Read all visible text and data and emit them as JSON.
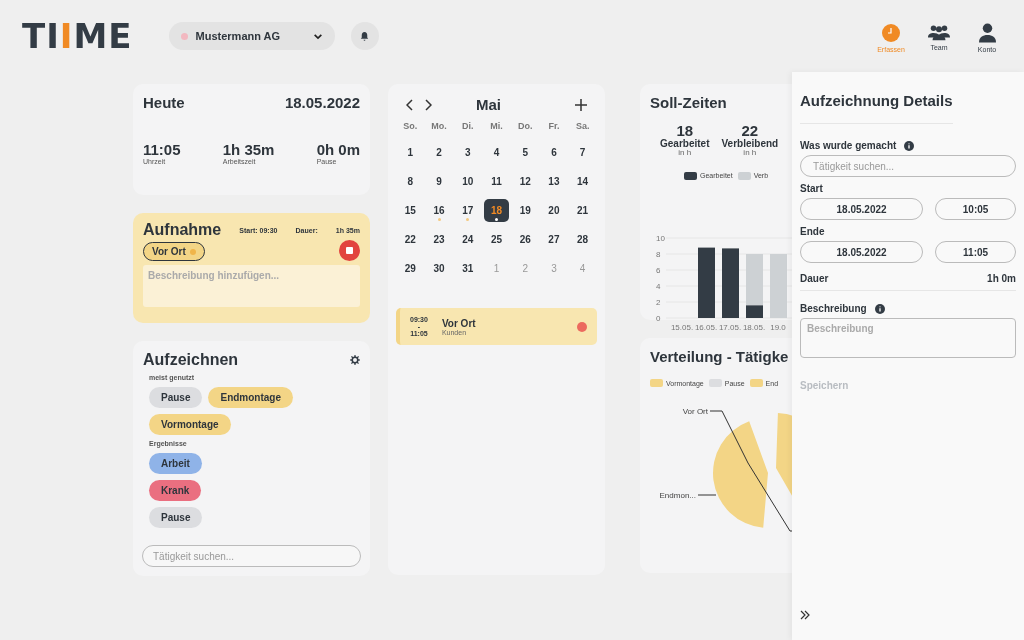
{
  "logo": [
    {
      "text": "TI",
      "accent": false
    },
    {
      "text": "I",
      "accent": true
    },
    {
      "text": "ME",
      "accent": false
    }
  ],
  "company": {
    "name": "Mustermann AG",
    "color": "#f2b8c0"
  },
  "nav": [
    {
      "label": "Erfassen",
      "kind": "clock",
      "selected": true
    },
    {
      "label": "Team",
      "kind": "team",
      "selected": false
    },
    {
      "label": "Konto",
      "kind": "user",
      "selected": false
    }
  ],
  "today": {
    "title": "Heute",
    "date": "18.05.2022",
    "stats": [
      {
        "value": "11:05",
        "label": "Uhrzeit"
      },
      {
        "value": "1h 35m",
        "label": "Arbeitszeit"
      },
      {
        "value": "0h 0m",
        "label": "Pause"
      }
    ]
  },
  "recording": {
    "title": "Aufnahme",
    "start": "Start: 09:30",
    "duration_label": "Dauer:",
    "duration": "1h 35m",
    "activity": {
      "label": "Vor Ort",
      "color": "#f0b54a"
    },
    "placeholder": "Beschreibung hinzufügen..."
  },
  "record": {
    "title": "Aufzeichnen",
    "groups": [
      {
        "label": "meist genutzt",
        "chips": [
          {
            "label": "Pause",
            "color": "#dcdde0"
          },
          {
            "label": "Endmontage",
            "color": "#f3d586"
          },
          {
            "label": "Vormontage",
            "color": "#f3d586"
          }
        ]
      },
      {
        "label": "Ergebnisse",
        "chips": [
          {
            "label": "Arbeit",
            "color": "#8fb3e8"
          },
          {
            "label": "Krank",
            "color": "#ea6f80"
          },
          {
            "label": "Pause",
            "color": "#dcdde0"
          }
        ]
      }
    ],
    "search_placeholder": "Tätigkeit suchen..."
  },
  "calendar": {
    "month": "Mai",
    "weekdays": [
      "So.",
      "Mo.",
      "Di.",
      "Mi.",
      "Do.",
      "Fr.",
      "Sa."
    ],
    "weeks": [
      [
        {
          "day": "1",
          "other_month": false,
          "selected": false,
          "has_entries": false
        },
        {
          "day": "2",
          "other_month": false,
          "selected": false,
          "has_entries": false
        },
        {
          "day": "3",
          "other_month": false,
          "selected": false,
          "has_entries": false
        },
        {
          "day": "4",
          "other_month": false,
          "selected": false,
          "has_entries": false
        },
        {
          "day": "5",
          "other_month": false,
          "selected": false,
          "has_entries": false
        },
        {
          "day": "6",
          "other_month": false,
          "selected": false,
          "has_entries": false
        },
        {
          "day": "7",
          "other_month": false,
          "selected": false,
          "has_entries": false
        }
      ],
      [
        {
          "day": "8",
          "other_month": false,
          "selected": false,
          "has_entries": false
        },
        {
          "day": "9",
          "other_month": false,
          "selected": false,
          "has_entries": false
        },
        {
          "day": "10",
          "other_month": false,
          "selected": false,
          "has_entries": false
        },
        {
          "day": "11",
          "other_month": false,
          "selected": false,
          "has_entries": false
        },
        {
          "day": "12",
          "other_month": false,
          "selected": false,
          "has_entries": false
        },
        {
          "day": "13",
          "other_month": false,
          "selected": false,
          "has_entries": false
        },
        {
          "day": "14",
          "other_month": false,
          "selected": false,
          "has_entries": false
        }
      ],
      [
        {
          "day": "15",
          "other_month": false,
          "selected": false,
          "has_entries": false
        },
        {
          "day": "16",
          "other_month": false,
          "selected": false,
          "has_entries": true
        },
        {
          "day": "17",
          "other_month": false,
          "selected": false,
          "has_entries": true
        },
        {
          "day": "18",
          "other_month": false,
          "selected": true,
          "has_entries": true
        },
        {
          "day": "19",
          "other_month": false,
          "selected": false,
          "has_entries": false
        },
        {
          "day": "20",
          "other_month": false,
          "selected": false,
          "has_entries": false
        },
        {
          "day": "21",
          "other_month": false,
          "selected": false,
          "has_entries": false
        }
      ],
      [
        {
          "day": "22",
          "other_month": false,
          "selected": false,
          "has_entries": false
        },
        {
          "day": "23",
          "other_month": false,
          "selected": false,
          "has_entries": false
        },
        {
          "day": "24",
          "other_month": false,
          "selected": false,
          "has_entries": false
        },
        {
          "day": "25",
          "other_month": false,
          "selected": false,
          "has_entries": false
        },
        {
          "day": "26",
          "other_month": false,
          "selected": false,
          "has_entries": false
        },
        {
          "day": "27",
          "other_month": false,
          "selected": false,
          "has_entries": false
        },
        {
          "day": "28",
          "other_month": false,
          "selected": false,
          "has_entries": false
        }
      ],
      [
        {
          "day": "29",
          "other_month": false,
          "selected": false,
          "has_entries": false
        },
        {
          "day": "30",
          "other_month": false,
          "selected": false,
          "has_entries": false
        },
        {
          "day": "31",
          "other_month": false,
          "selected": false,
          "has_entries": false
        },
        {
          "day": "1",
          "other_month": true,
          "selected": false,
          "has_entries": false
        },
        {
          "day": "2",
          "other_month": true,
          "selected": false,
          "has_entries": false
        },
        {
          "day": "3",
          "other_month": true,
          "selected": false,
          "has_entries": false
        },
        {
          "day": "4",
          "other_month": true,
          "selected": false,
          "has_entries": false
        }
      ]
    ],
    "entries": [
      {
        "start": "09:30",
        "separator": "-",
        "end": "11:05",
        "title": "Vor Ort",
        "subtitle": "Kunden",
        "color": "#ec6a5e"
      }
    ]
  },
  "targets": {
    "title": "Soll-Zeiten",
    "stats": [
      {
        "value": "18",
        "label": "Gearbeitet",
        "unit": "in h"
      },
      {
        "value": "22",
        "label": "Verbleibend",
        "unit": "in h"
      }
    ],
    "chart_data": {
      "type": "bar",
      "stacked": true,
      "grid": true,
      "categories": [
        "15.05.",
        "16.05.",
        "17.05.",
        "18.05.",
        "19.0"
      ],
      "yticks": [
        0,
        2,
        4,
        6,
        8,
        10
      ],
      "ylim": [
        0,
        10
      ],
      "series": [
        {
          "name": "Gearbeitet",
          "color": "#333c45",
          "values": [
            0,
            8.8,
            8.7,
            1.6,
            0
          ]
        },
        {
          "name": "Verb",
          "color": "#cdd1d4",
          "values": [
            0,
            0,
            0,
            6.4,
            8
          ]
        }
      ]
    }
  },
  "distribution": {
    "title": "Verteilung - Tätigke",
    "legend": [
      {
        "label": "Vormontage",
        "color": "#f3d586"
      },
      {
        "label": "Pause",
        "color": "#dcdde0"
      },
      {
        "label": "End",
        "color": "#f3d586"
      }
    ],
    "slice_labels": [
      "Vor Ort",
      "Endmon..."
    ]
  },
  "details": {
    "title": "Aufzeichnung Details",
    "activity_label": "Was wurde gemacht",
    "activity_placeholder": "Tätigkeit suchen...",
    "start_label": "Start",
    "start_date": "18.05.2022",
    "start_time": "10:05",
    "end_label": "Ende",
    "end_date": "18.05.2022",
    "end_time": "11:05",
    "duration_label": "Dauer",
    "duration": "1h 0m",
    "description_label": "Beschreibung",
    "description_placeholder": "Beschreibung",
    "save": {
      "label": "Speichern",
      "disabled": true
    }
  }
}
